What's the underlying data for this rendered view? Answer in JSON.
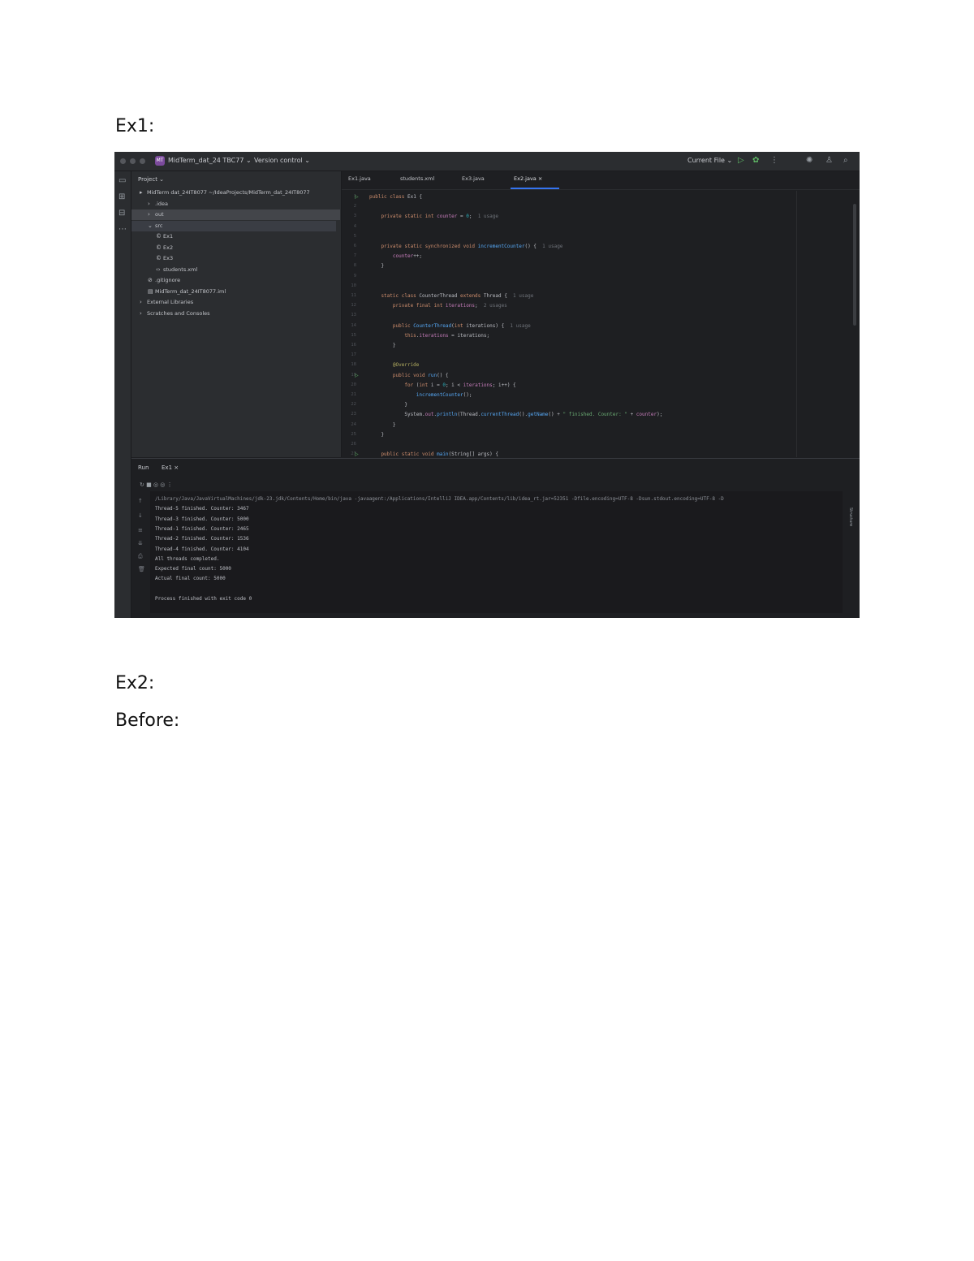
{
  "doc": {
    "heading_ex1": "Ex1:",
    "heading_ex2": "Ex2:",
    "heading_before": "Before:"
  },
  "ide": {
    "titlebar": {
      "project_badge": "MT",
      "project_name": "MidTerm_dat_24 TBC77 ⌄",
      "vcs": "Version control ⌄",
      "run_config": "Current File ⌄",
      "run_icon": "play-icon",
      "debug_icon": "bug-icon",
      "more_icon": "more-vertical-icon",
      "ai_icon": "ai-assistant-icon",
      "account_icon": "account-icon",
      "search_icon": "search-icon"
    },
    "project_panel": {
      "title": "Project ⌄",
      "tree": [
        {
          "label": "MidTerm dat_24IT8077 ~/IdeaProjects/MidTerm_dat_24IT8077",
          "icon": "▸",
          "indent": 0
        },
        {
          "label": ".idea",
          "icon": "›",
          "indent": 1
        },
        {
          "label": "out",
          "icon": "›",
          "indent": 1
        },
        {
          "label": "src",
          "icon": "⌄",
          "indent": 1
        },
        {
          "label": "Ex1",
          "icon": "©",
          "indent": 2
        },
        {
          "label": "Ex2",
          "icon": "©",
          "indent": 2
        },
        {
          "label": "Ex3",
          "icon": "©",
          "indent": 2
        },
        {
          "label": "students.xml",
          "icon": "‹›",
          "indent": 2
        },
        {
          "label": ".gitignore",
          "icon": "⊘",
          "indent": 1
        },
        {
          "label": "MidTerm_dat_24IT8077.iml",
          "icon": "▤",
          "indent": 1
        },
        {
          "label": "External Libraries",
          "icon": "›",
          "indent": 0
        },
        {
          "label": "Scratches and Consoles",
          "icon": "›",
          "indent": 0
        }
      ]
    },
    "tabs": [
      {
        "label": "Ex1.java",
        "active": false
      },
      {
        "label": "students.xml",
        "active": false
      },
      {
        "label": "Ex3.java",
        "active": false
      },
      {
        "label": "Ex2.java ×",
        "active": true
      }
    ],
    "editor": {
      "line_numbers": [
        "1",
        "2",
        "3",
        "4",
        "5",
        "6",
        "7",
        "8",
        "9",
        "10",
        "11",
        "12",
        "13",
        "14",
        "15",
        "16",
        "17",
        "18",
        "19",
        "20",
        "21",
        "22",
        "23",
        "24",
        "25",
        "26",
        "27"
      ],
      "lines": [
        {
          "parts": [
            [
              "kw",
              "public class "
            ],
            [
              "",
              "Ex1 {"
            ]
          ]
        },
        {
          "parts": []
        },
        {
          "parts": [
            [
              "kw",
              "    private static int "
            ],
            [
              "fld",
              "counter"
            ],
            [
              "",
              " = "
            ],
            [
              "num",
              "0"
            ],
            [
              "",
              ";"
            ],
            [
              "hint",
              "  1 usage"
            ]
          ]
        },
        {
          "parts": []
        },
        {
          "parts": []
        },
        {
          "parts": [
            [
              "kw",
              "    private static synchronized void "
            ],
            [
              "fn",
              "incrementCounter"
            ],
            [
              "",
              "() {"
            ],
            [
              "hint",
              "  1 usage"
            ]
          ]
        },
        {
          "parts": [
            [
              "fld",
              "        counter"
            ],
            [
              "",
              "++;"
            ]
          ]
        },
        {
          "parts": [
            [
              "",
              "    }"
            ]
          ]
        },
        {
          "parts": []
        },
        {
          "parts": []
        },
        {
          "parts": [
            [
              "kw",
              "    static class "
            ],
            [
              "",
              "CounterThread "
            ],
            [
              "kw",
              "extends "
            ],
            [
              "",
              "Thread {"
            ],
            [
              "hint",
              "  1 usage"
            ]
          ]
        },
        {
          "parts": [
            [
              "kw",
              "        private final int "
            ],
            [
              "fld",
              "iterations"
            ],
            [
              "",
              ";"
            ],
            [
              "hint",
              "  2 usages"
            ]
          ]
        },
        {
          "parts": []
        },
        {
          "parts": [
            [
              "kw",
              "        public "
            ],
            [
              "fn",
              "CounterThread"
            ],
            [
              "",
              "("
            ],
            [
              "kw",
              "int "
            ],
            [
              "",
              "iterations) {"
            ],
            [
              "hint",
              "  1 usage"
            ]
          ]
        },
        {
          "parts": [
            [
              "kw",
              "            this"
            ],
            [
              "",
              "."
            ],
            [
              "fld",
              "iterations"
            ],
            [
              "",
              " = iterations;"
            ]
          ]
        },
        {
          "parts": [
            [
              "",
              "        }"
            ]
          ]
        },
        {
          "parts": []
        },
        {
          "parts": [
            [
              "ann",
              "        @Override"
            ]
          ]
        },
        {
          "parts": [
            [
              "kw",
              "        public void "
            ],
            [
              "fn",
              "run"
            ],
            [
              "",
              "() {"
            ]
          ]
        },
        {
          "parts": [
            [
              "kw",
              "            for "
            ],
            [
              "",
              "("
            ],
            [
              "kw",
              "int "
            ],
            [
              "",
              "i = "
            ],
            [
              "num",
              "0"
            ],
            [
              "",
              "; i < "
            ],
            [
              "fld",
              "iterations"
            ],
            [
              "",
              "; i++) {"
            ]
          ]
        },
        {
          "parts": [
            [
              "",
              "                "
            ],
            [
              "fn",
              "incrementCounter"
            ],
            [
              "",
              "();"
            ]
          ]
        },
        {
          "parts": [
            [
              "",
              "            }"
            ]
          ]
        },
        {
          "parts": [
            [
              "",
              "            System."
            ],
            [
              "fld",
              "out"
            ],
            [
              "",
              "."
            ],
            [
              "fn",
              "println"
            ],
            [
              "",
              "(Thread."
            ],
            [
              "fn",
              "currentThread"
            ],
            [
              "",
              "()."
            ],
            [
              "fn",
              "getName"
            ],
            [
              "",
              "() + "
            ],
            [
              "str",
              "\" finished. Counter: \""
            ],
            [
              "",
              " + "
            ],
            [
              "fld",
              "counter"
            ],
            [
              "",
              ");"
            ]
          ]
        },
        {
          "parts": [
            [
              "",
              "        }"
            ]
          ]
        },
        {
          "parts": [
            [
              "",
              "    }"
            ]
          ]
        },
        {
          "parts": []
        },
        {
          "parts": [
            [
              "kw",
              "    public static void "
            ],
            [
              "fn",
              "main"
            ],
            [
              "",
              "(String[] args) {"
            ]
          ]
        }
      ]
    },
    "run_panel": {
      "title": "Run",
      "tab": "Ex1 ×",
      "side_label": "Structure",
      "console": [
        {
          "cls": "cmd",
          "text": "/Library/Java/JavaVirtualMachines/jdk-23.jdk/Contents/Home/bin/java -javaagent:/Applications/IntelliJ IDEA.app/Contents/lib/idea_rt.jar=52351 -Dfile.encoding=UTF-8 -Dsun.stdout.encoding=UTF-8 -D"
        },
        {
          "cls": "",
          "text": "Thread-5 finished. Counter: 3467"
        },
        {
          "cls": "",
          "text": "Thread-3 finished. Counter: 5000"
        },
        {
          "cls": "",
          "text": "Thread-1 finished. Counter: 2465"
        },
        {
          "cls": "",
          "text": "Thread-2 finished. Counter: 1536"
        },
        {
          "cls": "",
          "text": "Thread-4 finished. Counter: 4104"
        },
        {
          "cls": "",
          "text": "All threads completed."
        },
        {
          "cls": "",
          "text": "Expected final count: 5000"
        },
        {
          "cls": "",
          "text": "Actual final count: 5000"
        },
        {
          "cls": "",
          "text": ""
        },
        {
          "cls": "",
          "text": "Process finished with exit code 0"
        }
      ]
    }
  }
}
